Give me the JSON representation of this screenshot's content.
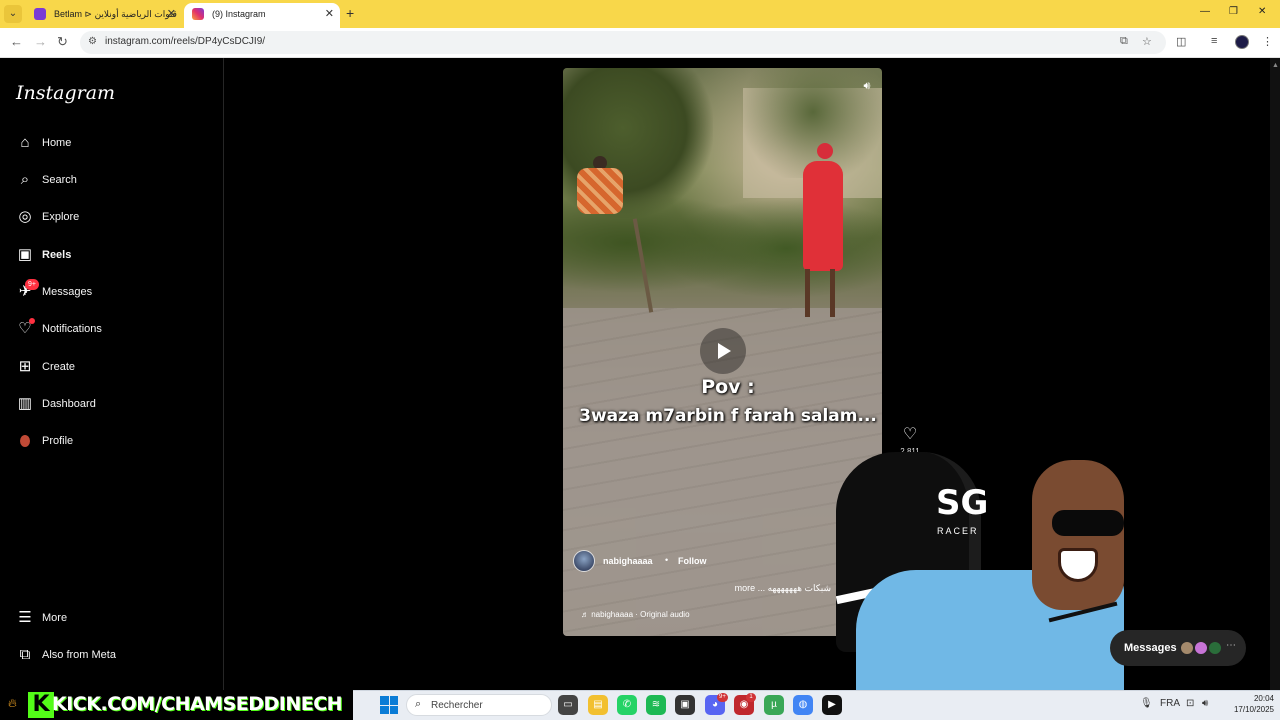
{
  "browser": {
    "tabs": [
      {
        "title": "Betlam ⊳ قنوات الرياضية أونلاين",
        "active": false
      },
      {
        "title": "(9) Instagram",
        "active": true
      }
    ],
    "url": "instagram.com/reels/DP4yCsDCJI9/"
  },
  "sidebar": {
    "logo": "Instagram",
    "items": [
      {
        "label": "Home",
        "icon": "home-icon"
      },
      {
        "label": "Search",
        "icon": "search-icon"
      },
      {
        "label": "Explore",
        "icon": "compass-icon"
      },
      {
        "label": "Reels",
        "icon": "reels-icon",
        "active": true
      },
      {
        "label": "Messages",
        "icon": "messenger-icon",
        "badge": "9+"
      },
      {
        "label": "Notifications",
        "icon": "heart-icon",
        "dot": true
      },
      {
        "label": "Create",
        "icon": "plus-square-icon"
      },
      {
        "label": "Dashboard",
        "icon": "chart-icon"
      },
      {
        "label": "Profile",
        "icon": "profile-avatar"
      }
    ],
    "bottom": [
      {
        "label": "More",
        "icon": "menu-icon"
      },
      {
        "label": "Also from Meta",
        "icon": "meta-apps-icon"
      }
    ]
  },
  "reel": {
    "caption_line1": "Pov :",
    "caption_line2": "3waza m7arbin f farah salam...",
    "author": "nabighaaaa",
    "separator": "•",
    "follow_label": "Follow",
    "description": "more ... شبكات هههههههه",
    "audio": "♬ nabighaaaa · Original audio",
    "likes": "2,811"
  },
  "overlay": {
    "chair_logo": "SG",
    "chair_sub": "RACER",
    "messages_label": "Messages"
  },
  "taskbar": {
    "banner": "KICK.COM/CHAMSEDDINECH",
    "search_placeholder": "Rechercher",
    "language": "FRA",
    "time": "20:04",
    "date": "17/10/2025",
    "discord_badge": "9+",
    "app_badge": "1"
  }
}
